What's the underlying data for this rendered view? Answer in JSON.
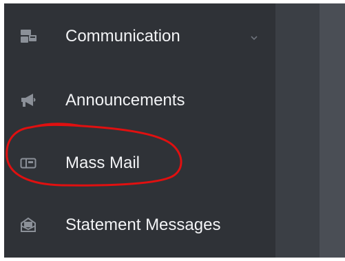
{
  "sidebar": {
    "items": [
      {
        "label": "Communication",
        "icon": "communication-icon",
        "has_chevron": true
      },
      {
        "label": "Announcements",
        "icon": "megaphone-icon"
      },
      {
        "label": "Mass Mail",
        "icon": "mailbox-icon"
      },
      {
        "label": "Statement Messages",
        "icon": "envelope-tray-icon"
      }
    ]
  },
  "colors": {
    "sidebar_bg": "#2f3237",
    "text": "#f2f3f5",
    "icon": "#8b9098",
    "annotation": "#e01010"
  }
}
